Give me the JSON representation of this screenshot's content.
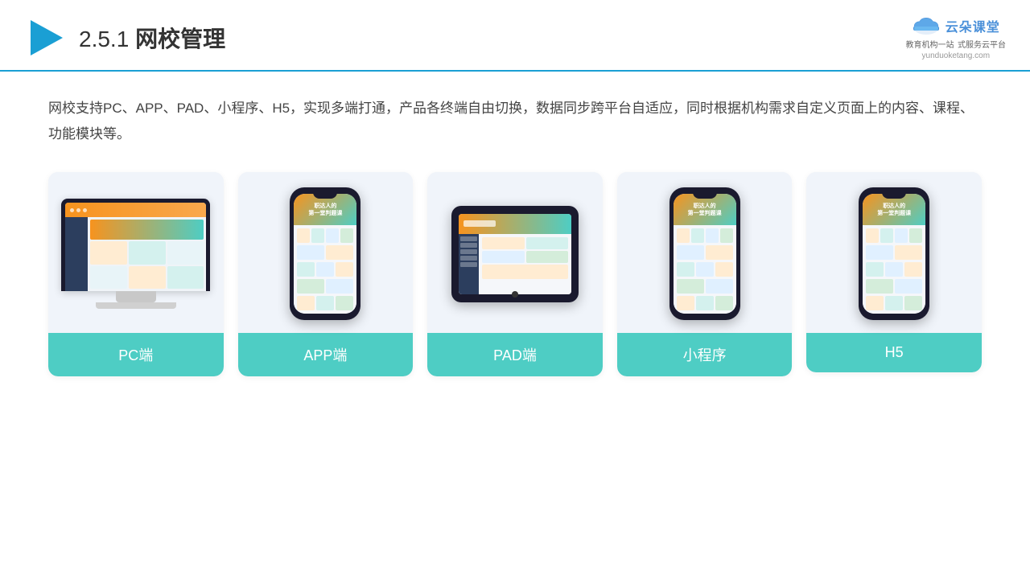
{
  "header": {
    "slide_number": "2.5.1",
    "title": "网校管理",
    "logo": {
      "brand_name": "云朵课堂",
      "tagline_line1": "教育机构一站",
      "tagline_line2": "式服务云平台",
      "domain": "yunduoketang.com"
    }
  },
  "description": {
    "text": "网校支持PC、APP、PAD、小程序、H5，实现多端打通，产品各终端自由切换，数据同步跨平台自适应，同时根据机构需求自定义页面上的内容、课程、功能模块等。"
  },
  "cards": [
    {
      "id": "pc",
      "label": "PC端",
      "device_type": "desktop"
    },
    {
      "id": "app",
      "label": "APP端",
      "device_type": "phone"
    },
    {
      "id": "pad",
      "label": "PAD端",
      "device_type": "tablet"
    },
    {
      "id": "miniprogram",
      "label": "小程序",
      "device_type": "phone"
    },
    {
      "id": "h5",
      "label": "H5",
      "device_type": "phone"
    }
  ],
  "colors": {
    "accent": "#4ecdc4",
    "brand_blue": "#1a9fd4",
    "orange": "#f7931e"
  }
}
